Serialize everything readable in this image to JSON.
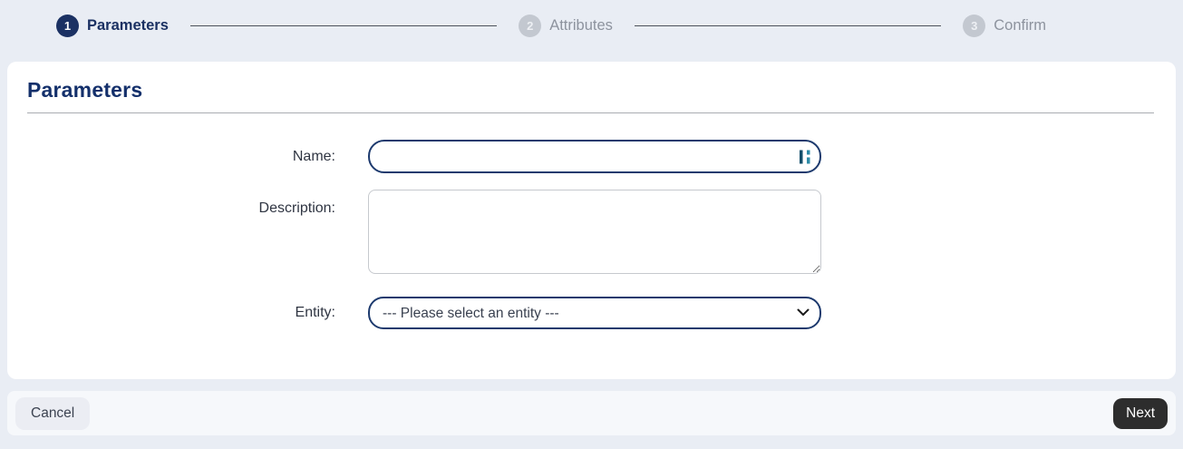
{
  "stepper": {
    "steps": [
      {
        "number": "1",
        "label": "Parameters",
        "state": "active"
      },
      {
        "number": "2",
        "label": "Attributes",
        "state": "inactive"
      },
      {
        "number": "3",
        "label": "Confirm",
        "state": "inactive"
      }
    ]
  },
  "panel": {
    "title": "Parameters"
  },
  "form": {
    "name_label": "Name:",
    "name_value": "",
    "description_label": "Description:",
    "description_value": "",
    "entity_label": "Entity:",
    "entity_selected_option": "--- Please select an entity ---"
  },
  "footer": {
    "cancel_label": "Cancel",
    "next_label": "Next"
  },
  "icons": {
    "name_field_icon": "extension-bars-icon",
    "select_icon": "chevron-down-icon"
  },
  "colors": {
    "page_bg": "#e9edf4",
    "accent_navy": "#1b3163",
    "inactive_gray": "#c3c8d0",
    "field_border": "#1d3a6e",
    "footer_bg": "#f6f8fb",
    "cancel_button_bg": "#ebedf3",
    "next_button_bg": "#2d2d2d",
    "icon_teal_dark": "#124f6b",
    "icon_teal": "#2e8ca8"
  }
}
